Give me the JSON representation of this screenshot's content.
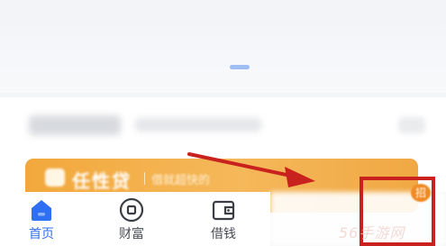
{
  "colors": {
    "accent_blue": "#2f6ff3",
    "banner_orange": "#f2a83c",
    "annotation_red": "#c8211e"
  },
  "loan_banner": {
    "brand": "任性贷",
    "slogan": "借就超快的"
  },
  "tabbar": {
    "tabs": [
      {
        "label": "首页",
        "icon": "home-icon",
        "active": true
      },
      {
        "label": "财富",
        "icon": "wealth-coin-icon",
        "active": false
      },
      {
        "label": "借钱",
        "icon": "wallet-icon",
        "active": false
      }
    ]
  },
  "badge": {
    "text": "招"
  },
  "watermark": {
    "text": "56手游网"
  }
}
